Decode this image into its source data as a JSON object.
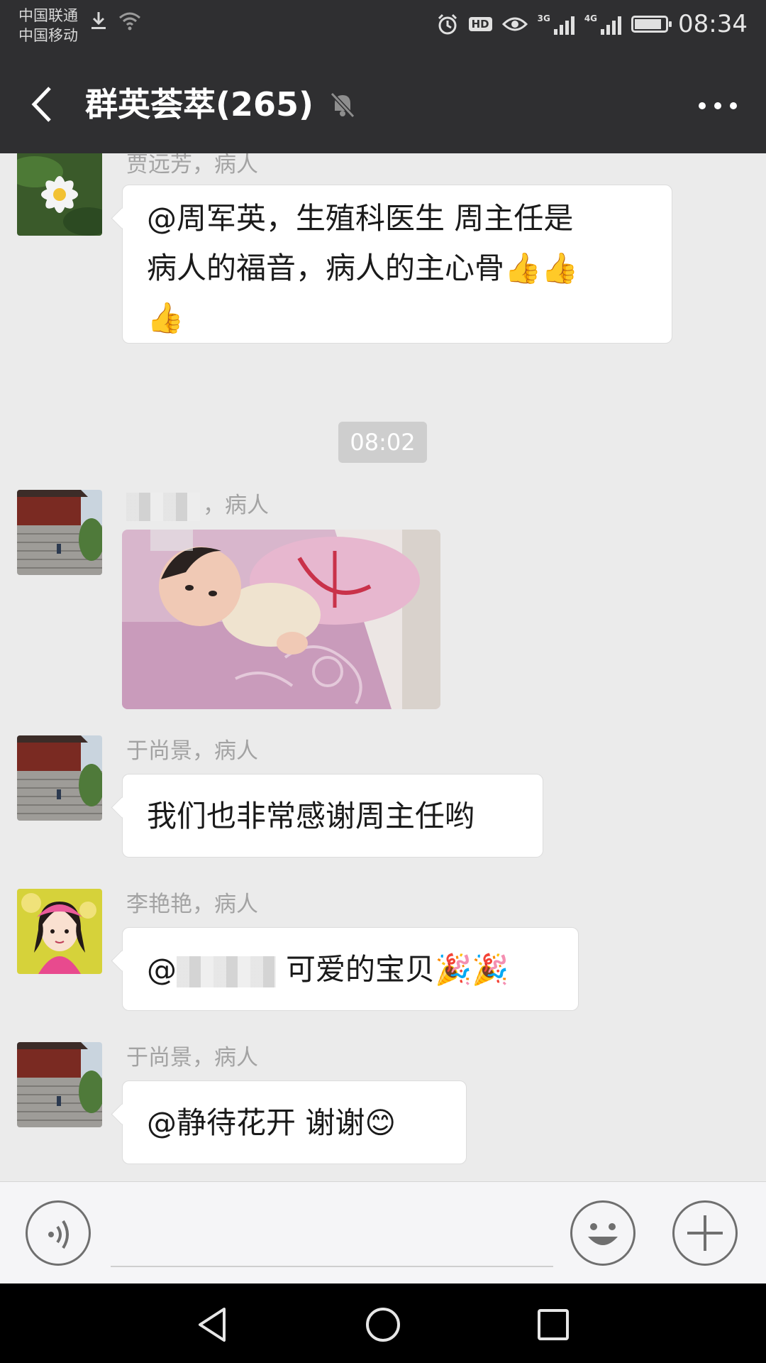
{
  "status": {
    "carrier1": "中国联通",
    "carrier2": "中国移动",
    "net_label_3g": "3G",
    "net_label_4g": "4G",
    "hd": "HD",
    "time": "08:34"
  },
  "header": {
    "title": "群英荟萃(265)",
    "icons": [
      "back-arrow-icon",
      "mute-bell-icon",
      "more-dots-icon"
    ]
  },
  "messages": [
    {
      "sender": "贾远芳，病人",
      "line1": "@周军英，生殖科医生  周主任是",
      "line2": "病人的福音，病人的主心骨👍👍",
      "line3": "👍"
    },
    {
      "time_chip": "08:02"
    },
    {
      "sender": "，病人",
      "type": "image",
      "image_desc": "baby-photo"
    },
    {
      "sender": "于尚景，病人",
      "text": "我们也非常感谢周主任哟"
    },
    {
      "sender": "李艳艳，病人",
      "at": "@",
      "text": "可爱的宝贝🎉🎉"
    },
    {
      "sender": "于尚景，病人",
      "text": "@静待花开  谢谢😊"
    }
  ],
  "input_bar": {
    "icons": [
      "voice-icon",
      "emoji-icon",
      "plus-icon"
    ]
  },
  "nav": {
    "icons": [
      "nav-back-icon",
      "nav-home-icon",
      "nav-recent-icon"
    ]
  },
  "colors": {
    "bar": "#2f2f31",
    "chat_bg": "#ebebeb",
    "bubble": "#ffffff"
  }
}
